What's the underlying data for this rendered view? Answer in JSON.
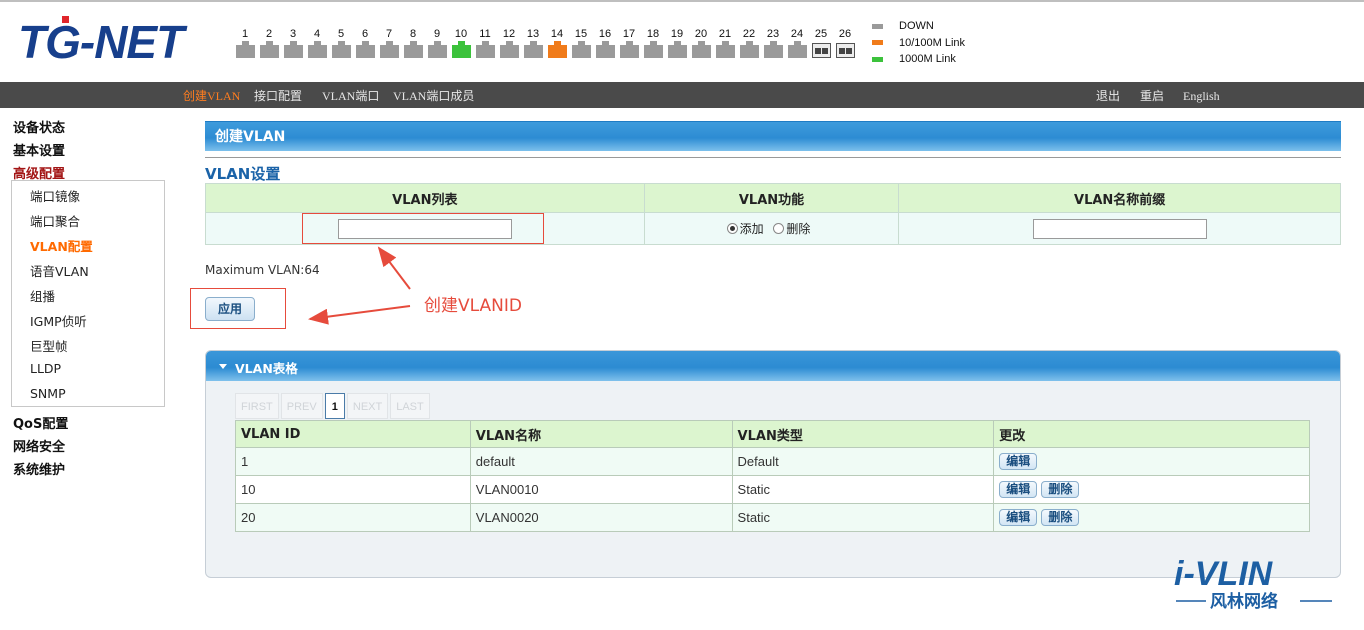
{
  "header": {
    "logo_text": "TG-NET",
    "ports": [
      {
        "num": "1",
        "status": "down"
      },
      {
        "num": "2",
        "status": "down"
      },
      {
        "num": "3",
        "status": "down"
      },
      {
        "num": "4",
        "status": "down"
      },
      {
        "num": "5",
        "status": "down"
      },
      {
        "num": "6",
        "status": "down"
      },
      {
        "num": "7",
        "status": "down"
      },
      {
        "num": "8",
        "status": "down"
      },
      {
        "num": "9",
        "status": "down"
      },
      {
        "num": "10",
        "status": "1000m"
      },
      {
        "num": "11",
        "status": "down"
      },
      {
        "num": "12",
        "status": "down"
      },
      {
        "num": "13",
        "status": "down"
      },
      {
        "num": "14",
        "status": "100m"
      },
      {
        "num": "15",
        "status": "down"
      },
      {
        "num": "16",
        "status": "down"
      },
      {
        "num": "17",
        "status": "down"
      },
      {
        "num": "18",
        "status": "down"
      },
      {
        "num": "19",
        "status": "down"
      },
      {
        "num": "20",
        "status": "down"
      },
      {
        "num": "21",
        "status": "down"
      },
      {
        "num": "22",
        "status": "down"
      },
      {
        "num": "23",
        "status": "down"
      },
      {
        "num": "24",
        "status": "down"
      },
      {
        "num": "25",
        "status": "sfp"
      },
      {
        "num": "26",
        "status": "sfp"
      }
    ],
    "legend": [
      {
        "label": "DOWN",
        "color": "#9a9a9a"
      },
      {
        "label": "10/100M Link",
        "color": "#f07b1a"
      },
      {
        "label": "1000M Link",
        "color": "#3cc23c"
      }
    ],
    "colors": {
      "down": "#9a9a9a",
      "100m": "#f07b1a",
      "1000m": "#3cc23c"
    }
  },
  "nav": {
    "tabs": [
      "创建VLAN",
      "接口配置",
      "VLAN端口",
      "VLAN端口成员"
    ],
    "right": [
      "退出",
      "重启",
      "English"
    ]
  },
  "sidebar": {
    "groups_top": [
      "设备状态",
      "基本设置",
      "高级配置"
    ],
    "sub": [
      "端口镜像",
      "端口聚合",
      "VLAN配置",
      "语音VLAN",
      "组播",
      "IGMP侦听",
      "巨型帧",
      "LLDP",
      "SNMP"
    ],
    "groups_bottom": [
      "QoS配置",
      "网络安全",
      "系统维护"
    ]
  },
  "main": {
    "title": "创建VLAN",
    "section_title": "VLAN设置",
    "cfg_headers": [
      "VLAN列表",
      "VLAN功能",
      "VLAN名称前缀"
    ],
    "vlan_list_value": "",
    "vlan_prefix_value": "",
    "radio_add": "添加",
    "radio_delete": "删除",
    "max_vlan": "Maximum VLAN:64",
    "apply_label": "应用",
    "annotation": "创建VLANID"
  },
  "vlan_table": {
    "title": "VLAN表格",
    "pager": [
      "FIRST",
      "PREV",
      "1",
      "NEXT",
      "LAST"
    ],
    "headers": [
      "VLAN ID",
      "VLAN名称",
      "VLAN类型",
      "更改"
    ],
    "rows": [
      {
        "id": "1",
        "name": "default",
        "type": "Default",
        "actions": [
          "编辑"
        ]
      },
      {
        "id": "10",
        "name": "VLAN0010",
        "type": "Static",
        "actions": [
          "编辑",
          "删除"
        ]
      },
      {
        "id": "20",
        "name": "VLAN0020",
        "type": "Static",
        "actions": [
          "编辑",
          "删除"
        ]
      }
    ]
  },
  "watermark": {
    "brand": "i-VLIN",
    "sub": "风林网络"
  }
}
